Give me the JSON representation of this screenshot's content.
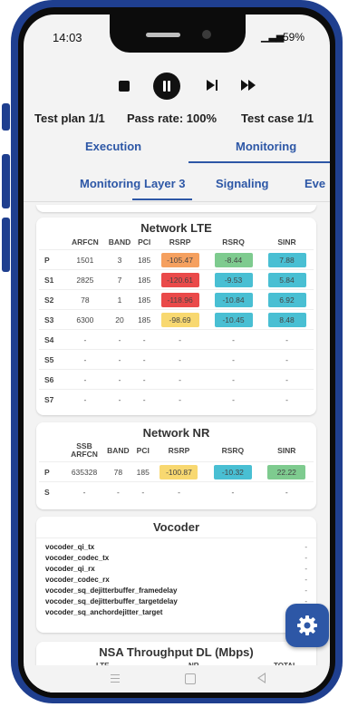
{
  "status_bar": {
    "time": "14:03",
    "signal": "📶",
    "battery": "59%"
  },
  "header": {
    "test_plan": "Test plan 1/1",
    "pass_rate": "Pass rate: 100%",
    "test_case": "Test case 1/1"
  },
  "main_tabs": [
    "Execution",
    "Monitoring"
  ],
  "sub_tabs": [
    "Monitoring",
    "Layer 3",
    "Signaling",
    "Eve"
  ],
  "colors": {
    "accent": "#2d57a6",
    "frame": "#1f3f8f",
    "orange": "#f5a05f",
    "red": "#ea4a4a",
    "yellow": "#f8d870",
    "green": "#7ecb8f",
    "cyan": "#49bfd3"
  },
  "lte": {
    "title": "Network LTE",
    "headers": [
      "",
      "ARFCN",
      "BAND",
      "PCI",
      "RSRP",
      "RSRQ",
      "SINR"
    ],
    "rows": [
      [
        "P",
        "1501",
        "3",
        "185",
        "-105.47",
        "-8.44",
        "7.88"
      ],
      [
        "S1",
        "2825",
        "7",
        "185",
        "-120.61",
        "-9.53",
        "5.84"
      ],
      [
        "S2",
        "78",
        "1",
        "185",
        "-118.96",
        "-10.84",
        "6.92"
      ],
      [
        "S3",
        "6300",
        "20",
        "185",
        "-98.69",
        "-10.45",
        "8.48"
      ],
      [
        "S4",
        "-",
        "-",
        "-",
        "-",
        "-",
        "-"
      ],
      [
        "S5",
        "-",
        "-",
        "-",
        "-",
        "-",
        "-"
      ],
      [
        "S6",
        "-",
        "-",
        "-",
        "-",
        "-",
        "-"
      ],
      [
        "S7",
        "-",
        "-",
        "-",
        "-",
        "-",
        "-"
      ]
    ]
  },
  "nr": {
    "title": "Network NR",
    "headers": [
      "",
      "SSB ARFCN",
      "BAND",
      "PCI",
      "RSRP",
      "RSRQ",
      "SINR"
    ],
    "rows": [
      [
        "P",
        "635328",
        "78",
        "185",
        "-100.87",
        "-10.32",
        "22.22"
      ],
      [
        "S",
        "-",
        "-",
        "-",
        "-",
        "-",
        "-"
      ]
    ]
  },
  "vocoder": {
    "title": "Vocoder",
    "items": [
      {
        "label": "vocoder_qi_tx",
        "value": "-"
      },
      {
        "label": "vocoder_codec_tx",
        "value": "-"
      },
      {
        "label": "vocoder_qi_rx",
        "value": "-"
      },
      {
        "label": "vocoder_codec_rx",
        "value": "-"
      },
      {
        "label": "vocoder_sq_dejitterbuffer_framedelay",
        "value": "-"
      },
      {
        "label": "vocoder_sq_dejitterbuffer_targetdelay",
        "value": "-"
      },
      {
        "label": "vocoder_sq_anchordejitter_target",
        "value": "-"
      }
    ]
  },
  "nsa": {
    "title": "NSA Throughput DL (Mbps)",
    "headers": [
      "LTE",
      "NR",
      "TOTAL"
    ]
  },
  "fab_icon": "gear-icon"
}
